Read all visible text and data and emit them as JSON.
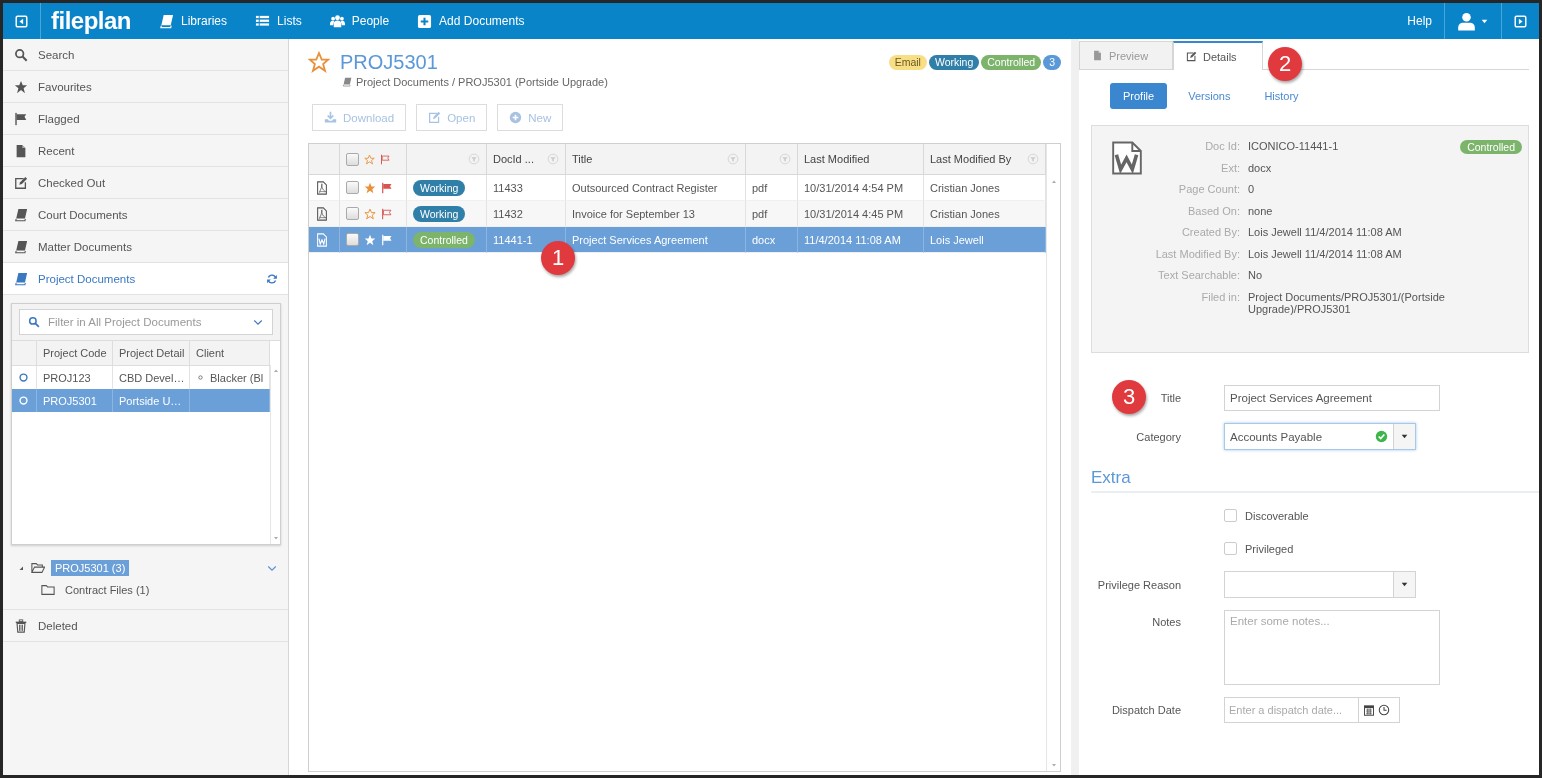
{
  "nav": {
    "logo": "fileplan",
    "items": [
      {
        "label": "Libraries"
      },
      {
        "label": "Lists"
      },
      {
        "label": "People"
      },
      {
        "label": "Add Documents"
      }
    ],
    "help": "Help"
  },
  "sidebar": {
    "items": [
      {
        "label": "Search",
        "selected": false
      },
      {
        "label": "Favourites",
        "selected": false
      },
      {
        "label": "Flagged",
        "selected": false
      },
      {
        "label": "Recent",
        "selected": false
      },
      {
        "label": "Checked Out",
        "selected": false
      },
      {
        "label": "Court Documents",
        "selected": false
      },
      {
        "label": "Matter Documents",
        "selected": false
      },
      {
        "label": "Project Documents",
        "selected": true
      }
    ],
    "bottom_items": [
      {
        "label": "Deleted",
        "selected": false
      }
    ]
  },
  "project_filter": {
    "placeholder": "Filter in All Project Documents",
    "columns": [
      "Project Code",
      "Project Detail",
      "Client"
    ],
    "rows": [
      {
        "code": "PROJ123",
        "detail": "CBD Devel…",
        "client": "Blacker (Bl",
        "selected": false
      },
      {
        "code": "PROJ5301",
        "detail": "Portside U…",
        "selected": true
      }
    ]
  },
  "tree": [
    {
      "label": "PROJ5301 (3)",
      "selected": true,
      "expanded": true,
      "children": [
        {
          "label": "Contract Files (1)",
          "selected": false
        }
      ]
    }
  ],
  "document": {
    "title": "PROJ5301",
    "favourite": false,
    "breadcrumb": "Project Documents / PROJ5301 (Portside Upgrade)",
    "badges": [
      {
        "label": "Email",
        "color": "#f8df85"
      },
      {
        "label": "Working",
        "color": "#2f7fa8"
      },
      {
        "label": "Controlled",
        "color": "#7db46c"
      },
      {
        "label": "3",
        "color": "#5b98d8"
      }
    ]
  },
  "toolbar": [
    {
      "label": "Download",
      "disabled": true
    },
    {
      "label": "Open",
      "disabled": true
    },
    {
      "label": "New",
      "disabled": true
    }
  ],
  "documents": {
    "all_checked": false,
    "columns": [
      {
        "filter": false
      },
      {
        "filter": false
      },
      {
        "filter": true
      },
      {
        "label": "DocId ...",
        "filter": true
      },
      {
        "label": "Title",
        "filter": true
      },
      {
        "filter": true
      },
      {
        "label": "Last Modified",
        "filter": false
      },
      {
        "label": "Last Modified By",
        "filter": true
      }
    ],
    "rows": [
      {
        "kind": "pdf",
        "checked": false,
        "favourite": true,
        "flagged": true,
        "status": "Working",
        "color": "#2f7fa8",
        "doc_id": "11433",
        "title": "Outsourced Contract Register",
        "ext": "pdf",
        "modified": "10/31/2014 4:54 PM",
        "modified_by": "Cristian Jones",
        "selected": false
      },
      {
        "kind": "pdf",
        "checked": false,
        "favourite": false,
        "flagged": false,
        "status": "Working",
        "color": "#2f7fa8",
        "doc_id": "11432",
        "title": "Invoice for September 13",
        "ext": "pdf",
        "modified": "10/31/2014 4:45 PM",
        "modified_by": "Cristian Jones",
        "selected": false
      },
      {
        "kind": "word",
        "checked": false,
        "favourite": true,
        "flagged": true,
        "status": "Controlled",
        "color": "#7db46c",
        "doc_id": "11441-1",
        "title": "Project Services Agreement",
        "ext": "docx",
        "modified": "11/4/2014 11:08 AM",
        "modified_by": "Lois Jewell",
        "selected": true
      }
    ]
  },
  "details": {
    "tabs": [
      {
        "label": "Preview",
        "selected": false
      },
      {
        "label": "Details",
        "selected": true
      }
    ],
    "subtabs": [
      {
        "label": "Profile",
        "selected": true
      },
      {
        "label": "Versions",
        "selected": false
      },
      {
        "label": "History",
        "selected": false
      }
    ],
    "status": {
      "label": "Controlled",
      "color": "#7db46c"
    },
    "fields": [
      {
        "label": "Doc Id:",
        "value": "ICONICO-11441-1"
      },
      {
        "label": "Ext:",
        "value": "docx"
      },
      {
        "label": "Page Count:",
        "value": "0"
      },
      {
        "label": "Based On:",
        "value": "none"
      },
      {
        "label": "Created By:",
        "value": "Lois Jewell 11/4/2014 11:08 AM"
      },
      {
        "label": "Last Modified By:",
        "value": "Lois Jewell 11/4/2014 11:08 AM"
      },
      {
        "label": "Text Searchable:",
        "value": "No"
      },
      {
        "label": "Filed in:",
        "value": "Project Documents/PROJ5301/(Portside Upgrade)/PROJ5301"
      }
    ]
  },
  "form": {
    "title": {
      "label": "Title",
      "value": "Project Services Agreement"
    },
    "category": {
      "label": "Category",
      "value": "Accounts Payable",
      "valid": true
    },
    "section": "Extra",
    "checkboxes": [
      {
        "label": "Discoverable",
        "checked": false
      },
      {
        "label": "Privileged",
        "checked": false
      }
    ],
    "privilege_reason": {
      "label": "Privilege Reason"
    },
    "notes": {
      "label": "Notes",
      "placeholder": "Enter some notes..."
    },
    "dispatch_date": {
      "label": "Dispatch Date",
      "placeholder": "Enter a dispatch date..."
    }
  },
  "callouts": [
    "1",
    "2",
    "3"
  ]
}
